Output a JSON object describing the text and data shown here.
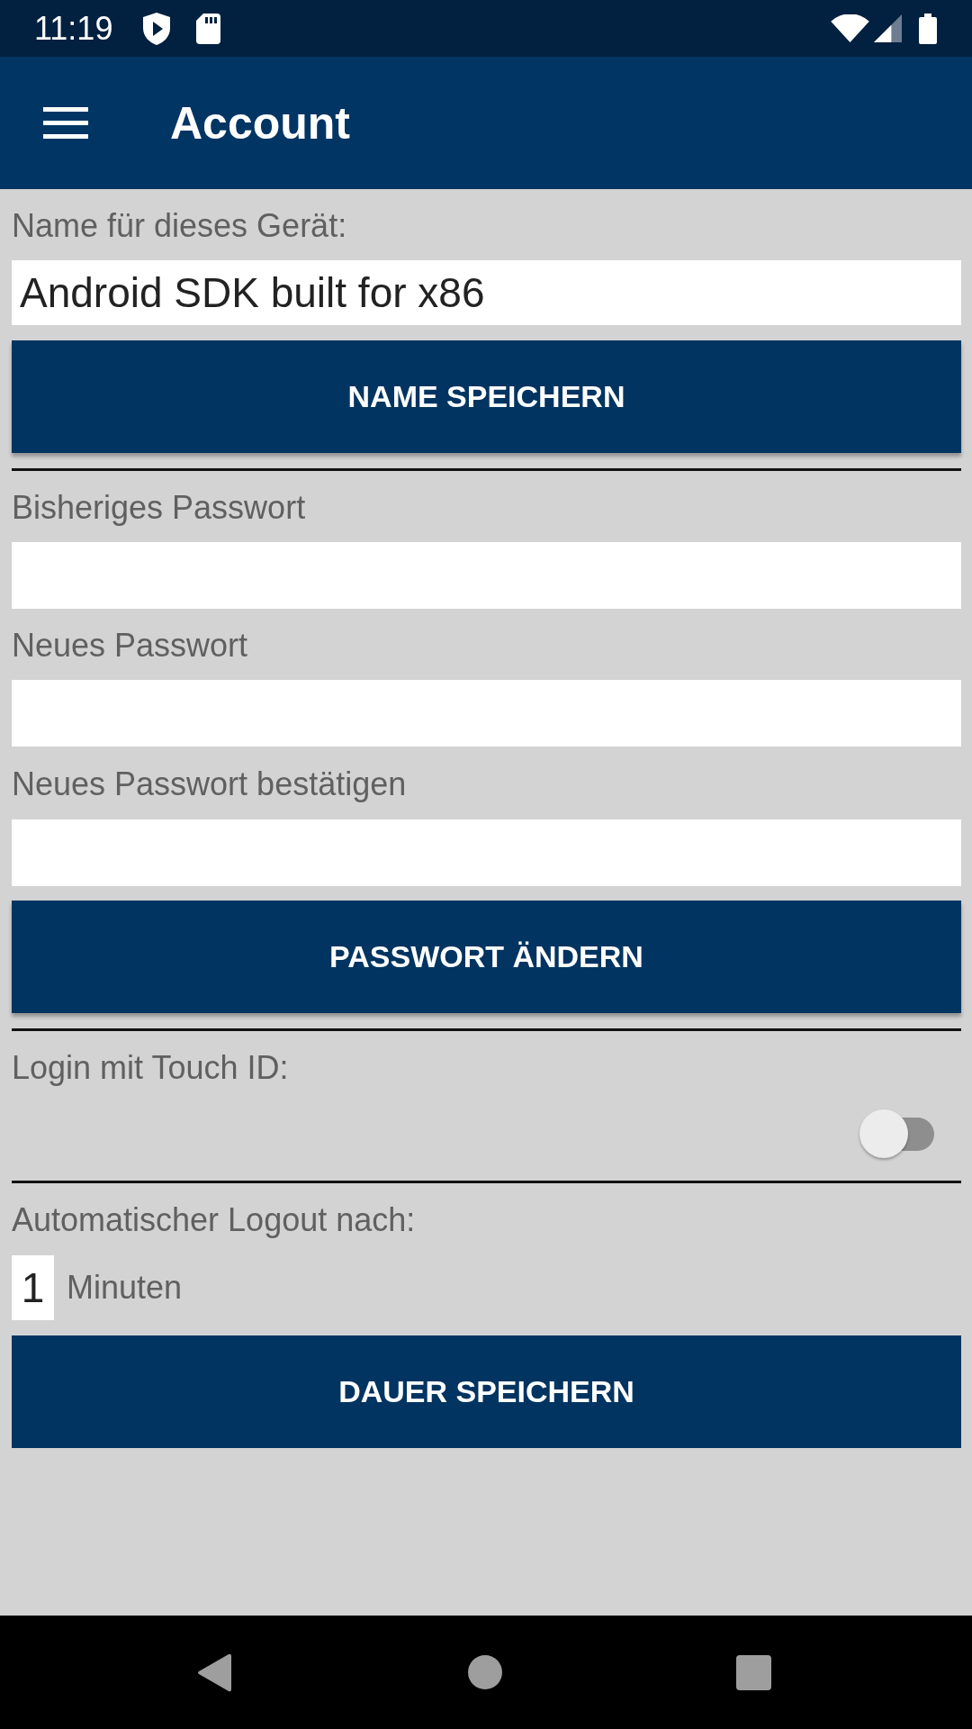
{
  "status_bar": {
    "time": "11:19"
  },
  "app_bar": {
    "title": "Account"
  },
  "device_name": {
    "label": "Name für dieses Gerät:",
    "value": "Android SDK built for x86",
    "button": "NAME SPEICHERN"
  },
  "password_change": {
    "fields": [
      {
        "label": "Bisheriges Passwort"
      },
      {
        "label": "Neues Passwort"
      },
      {
        "label": "Neues Passwort bestätigen"
      }
    ],
    "button": "PASSWORT ÄNDERN"
  },
  "touch_id": {
    "label": "Login mit Touch ID:",
    "on": false
  },
  "auto_logout": {
    "label": "Automatischer Logout nach:",
    "value": "1",
    "unit": "Minuten",
    "button": "DAUER SPEICHERN"
  }
}
